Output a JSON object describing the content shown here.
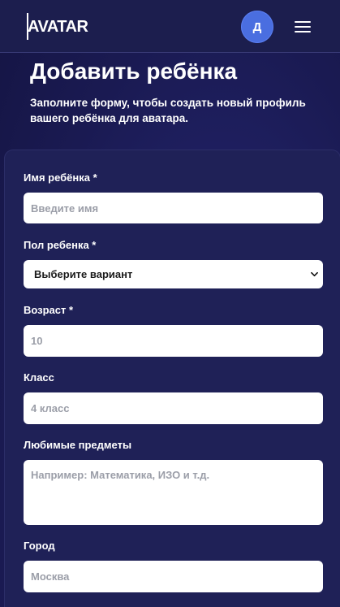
{
  "header": {
    "logo": "AVATAR",
    "avatar_initial": "Д",
    "menu_icon": "hamburger-icon"
  },
  "page": {
    "title": "Добавить ребёнка",
    "subtitle": "Заполните форму, чтобы создать новый профиль вашего ребёнка для аватара."
  },
  "form": {
    "name": {
      "label": "Имя ребёнка *",
      "placeholder": "Введите имя"
    },
    "gender": {
      "label": "Пол ребенка *",
      "selected": "Выберите вариант"
    },
    "age": {
      "label": "Возраст *",
      "placeholder": "10"
    },
    "grade": {
      "label": "Класс",
      "placeholder": "4 класс"
    },
    "subjects": {
      "label": "Любимые предметы",
      "placeholder": "Например: Математика, ИЗО и т.д."
    },
    "city": {
      "label": "Город",
      "placeholder": "Москва"
    }
  }
}
